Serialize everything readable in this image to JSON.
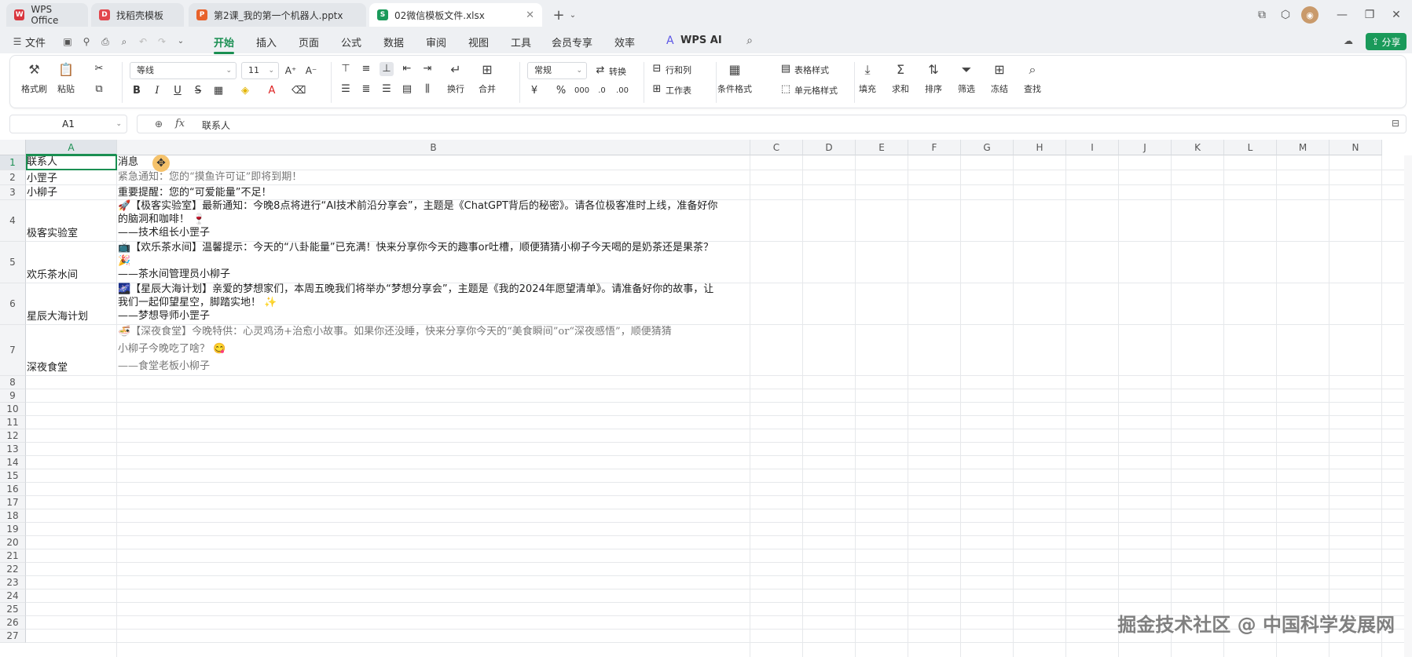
{
  "tabs": [
    {
      "label": "WPS Office",
      "icon": "wps-logo-icon",
      "color": "#d9363e",
      "glyph": "W"
    },
    {
      "label": "找稻壳模板",
      "icon": "docer-icon",
      "color": "#e2474d",
      "glyph": "D"
    },
    {
      "label": "第2课_我的第一个机器人.pptx",
      "icon": "pptx-icon",
      "color": "#e8622b",
      "glyph": "P"
    },
    {
      "label": "02微信模板文件.xlsx",
      "icon": "xlsx-icon",
      "color": "#1a9a5a",
      "glyph": "S"
    }
  ],
  "menu": {
    "file": "文件",
    "items": [
      "开始",
      "插入",
      "页面",
      "公式",
      "数据",
      "审阅",
      "视图",
      "工具",
      "会员专享",
      "效率"
    ],
    "ai": "WPS AI",
    "share": "分享"
  },
  "ribbon": {
    "format_painter": "格式刷",
    "paste": "粘贴",
    "font_name": "等线",
    "font_size": "11",
    "wrap": "换行",
    "merge": "合并",
    "number_format": "常规",
    "convert": "转换",
    "row_col": "行和列",
    "worksheet": "工作表",
    "cond_format": "条件格式",
    "table_style": "表格样式",
    "cell_style": "单元格样式",
    "fill": "填充",
    "sum": "求和",
    "sort": "排序",
    "filter": "筛选",
    "freeze": "冻结",
    "find": "查找"
  },
  "formula_bar": {
    "name_box": "A1",
    "value": "联系人"
  },
  "columns": [
    "A",
    "B",
    "C",
    "D",
    "E",
    "F",
    "G",
    "H",
    "I",
    "J",
    "K",
    "L",
    "M",
    "N"
  ],
  "rows": [
    "1",
    "2",
    "3",
    "4",
    "5",
    "6",
    "7",
    "8",
    "9",
    "10",
    "11",
    "12",
    "13",
    "14",
    "15",
    "16",
    "17",
    "18",
    "19",
    "20",
    "21",
    "22",
    "23",
    "24",
    "25",
    "26",
    "27"
  ],
  "cells": {
    "a1": "联系人",
    "b1": "消息",
    "a2": "小罡子",
    "b2": "紧急通知：您的“摸鱼许可证”即将到期！",
    "a3": "小柳子",
    "b3": "重要提醒：您的“可爱能量”不足！",
    "a4": "极客实验室",
    "b4_l1": "🚀【极客实验室】最新通知：今晚8点将进行“AI技术前沿分享会”，主题是《ChatGPT背后的秘密》。请各位极客准时上线，准备好你",
    "b4_l2": "的脑洞和咖啡！ 🍷",
    "b4_l3": "——技术组长小罡子",
    "a5": "欢乐茶水间",
    "b5_l1": "📺【欢乐茶水间】温馨提示：今天的“八卦能量”已充满！快来分享你今天的趣事or吐槽，顺便猜猜小柳子今天喝的是奶茶还是果茶？",
    "b5_l2": "🎉",
    "b5_l3": "——茶水间管理员小柳子",
    "a6": "星辰大海计划",
    "b6_l1": "🌌【星辰大海计划】亲爱的梦想家们，本周五晚我们将举办“梦想分享会”，主题是《我的2024年愿望清单》。请准备好你的故事，让",
    "b6_l2": "我们一起仰望星空，脚踏实地！ ✨",
    "b6_l3": "——梦想导师小罡子",
    "a7": "深夜食堂",
    "b7_l1": "🍜【深夜食堂】今晚特供：心灵鸡汤+治愈小故事。如果你还没睡，快来分享你今天的“美食瞬间”or“深夜感悟”，顺便猜猜",
    "b7_l2": "小柳子今晚吃了啥？ 😋",
    "b7_l3": "——食堂老板小柳子"
  },
  "watermark": "掘金技术社区 @ 中国科学发展网",
  "colors": {
    "accent": "#1a8f52",
    "share": "#1a9a5a"
  }
}
